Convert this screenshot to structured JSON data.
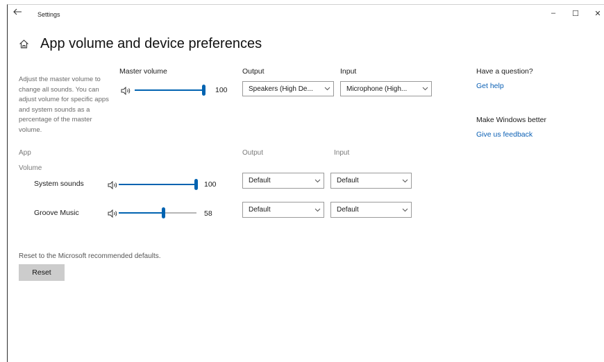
{
  "window": {
    "title": "Settings",
    "controls": {
      "minimize": "–",
      "maximize": "☐",
      "close": "✕"
    }
  },
  "page": {
    "title": "App volume and device preferences"
  },
  "master": {
    "description": "Adjust the master volume to change all sounds. You can adjust volume for specific apps and system sounds as a percentage of the master volume.",
    "label": "Master volume",
    "value": "100",
    "level": 1.0
  },
  "output": {
    "label": "Output",
    "selected": "Speakers (High De..."
  },
  "input": {
    "label": "Input",
    "selected": "Microphone (High..."
  },
  "help": {
    "question": "Have a question?",
    "get_help": "Get help",
    "better": "Make Windows better",
    "feedback": "Give us feedback"
  },
  "apps": {
    "app_header": "App",
    "volume_header": "Volume",
    "output_header": "Output",
    "input_header": "Input",
    "rows": [
      {
        "name": "System sounds",
        "value": "100",
        "level": 1.0,
        "output": "Default",
        "input": "Default"
      },
      {
        "name": "Groove Music",
        "value": "58",
        "level": 0.58,
        "output": "Default",
        "input": "Default"
      }
    ]
  },
  "reset": {
    "description": "Reset to the Microsoft recommended defaults.",
    "button": "Reset"
  },
  "colors": {
    "accent": "#0063b1",
    "link": "#0a5fb4"
  }
}
